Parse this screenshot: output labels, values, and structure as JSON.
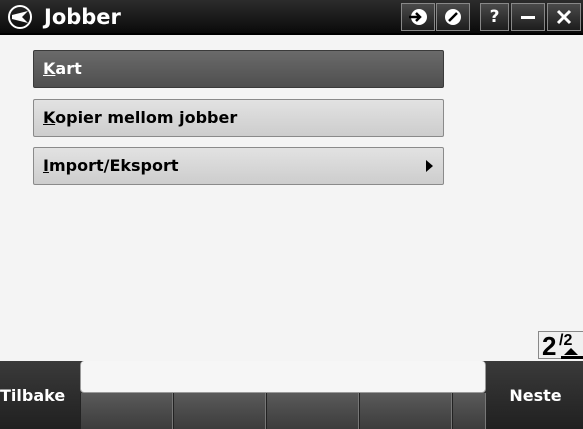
{
  "window": {
    "title": "Jobber",
    "buttons": {
      "help": "?"
    }
  },
  "menu": {
    "items": [
      {
        "label": "Kart",
        "mnemonic": "K",
        "rest": "art",
        "selected": true,
        "has_submenu": false
      },
      {
        "label": "Kopier mellom jobber",
        "mnemonic": "K",
        "rest": "opier mellom jobber",
        "selected": false,
        "has_submenu": false
      },
      {
        "label": "Import/Eksport",
        "mnemonic": "I",
        "rest": "mport/Eksport",
        "selected": false,
        "has_submenu": true
      }
    ]
  },
  "page_indicator": {
    "current": "2",
    "separator": "/",
    "total": "2"
  },
  "softkeys": {
    "back": "Tilbake",
    "next": "Neste"
  },
  "status_field": {
    "value": ""
  },
  "colors": {
    "titlebar": "#1a1a1a",
    "selected_item": "#5c5c5c",
    "client_bg": "#f4f4f4"
  }
}
